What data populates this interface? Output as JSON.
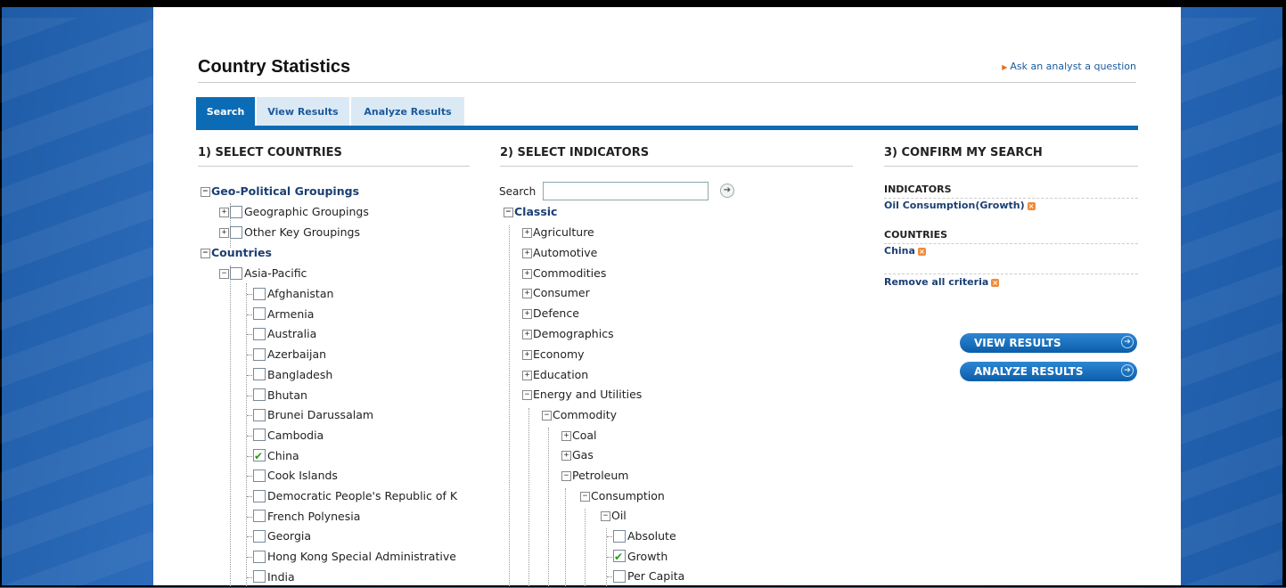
{
  "page": {
    "title": "Country Statistics",
    "ask_link": "Ask an analyst a question"
  },
  "tabs": [
    {
      "label": "Search",
      "active": true
    },
    {
      "label": "View Results",
      "active": false
    },
    {
      "label": "Analyze Results",
      "active": false
    }
  ],
  "countries": {
    "heading": "1) SELECT COUNTRIES",
    "groupings": "Geo-Political Groupings",
    "geographic": "Geographic Groupings",
    "other": "Other Key Groupings",
    "countries_root": "Countries",
    "region": "Asia-Pacific",
    "items": [
      {
        "label": "Afghanistan",
        "checked": false
      },
      {
        "label": "Armenia",
        "checked": false
      },
      {
        "label": "Australia",
        "checked": false
      },
      {
        "label": "Azerbaijan",
        "checked": false
      },
      {
        "label": "Bangladesh",
        "checked": false
      },
      {
        "label": "Bhutan",
        "checked": false
      },
      {
        "label": "Brunei Darussalam",
        "checked": false
      },
      {
        "label": "Cambodia",
        "checked": false
      },
      {
        "label": "China",
        "checked": true
      },
      {
        "label": "Cook Islands",
        "checked": false
      },
      {
        "label": "Democratic People's Republic of K",
        "checked": false
      },
      {
        "label": "French Polynesia",
        "checked": false
      },
      {
        "label": "Georgia",
        "checked": false
      },
      {
        "label": "Hong Kong Special Administrative",
        "checked": false
      },
      {
        "label": "India",
        "checked": false
      }
    ]
  },
  "indicators": {
    "heading": "2) SELECT INDICATORS",
    "search_label": "Search",
    "search_value": "",
    "root": "Classic",
    "categories": [
      "Agriculture",
      "Automotive",
      "Commodities",
      "Consumer",
      "Defence",
      "Demographics",
      "Economy",
      "Education"
    ],
    "energy": "Energy and Utilities",
    "commodity": "Commodity",
    "coal": "Coal",
    "gas": "Gas",
    "petroleum": "Petroleum",
    "consumption": "Consumption",
    "oil": "Oil",
    "oil_items": [
      {
        "label": "Absolute",
        "checked": false
      },
      {
        "label": "Growth",
        "checked": true
      },
      {
        "label": "Per Capita",
        "checked": false
      }
    ]
  },
  "confirm": {
    "heading": "3) CONFIRM MY SEARCH",
    "indicators_label": "INDICATORS",
    "indicator_value": "Oil Consumption(Growth)",
    "countries_label": "COUNTRIES",
    "country_value": "China",
    "remove_all": "Remove all criteria",
    "view_results": "VIEW RESULTS",
    "analyze_results": "ANALYZE RESULTS"
  }
}
